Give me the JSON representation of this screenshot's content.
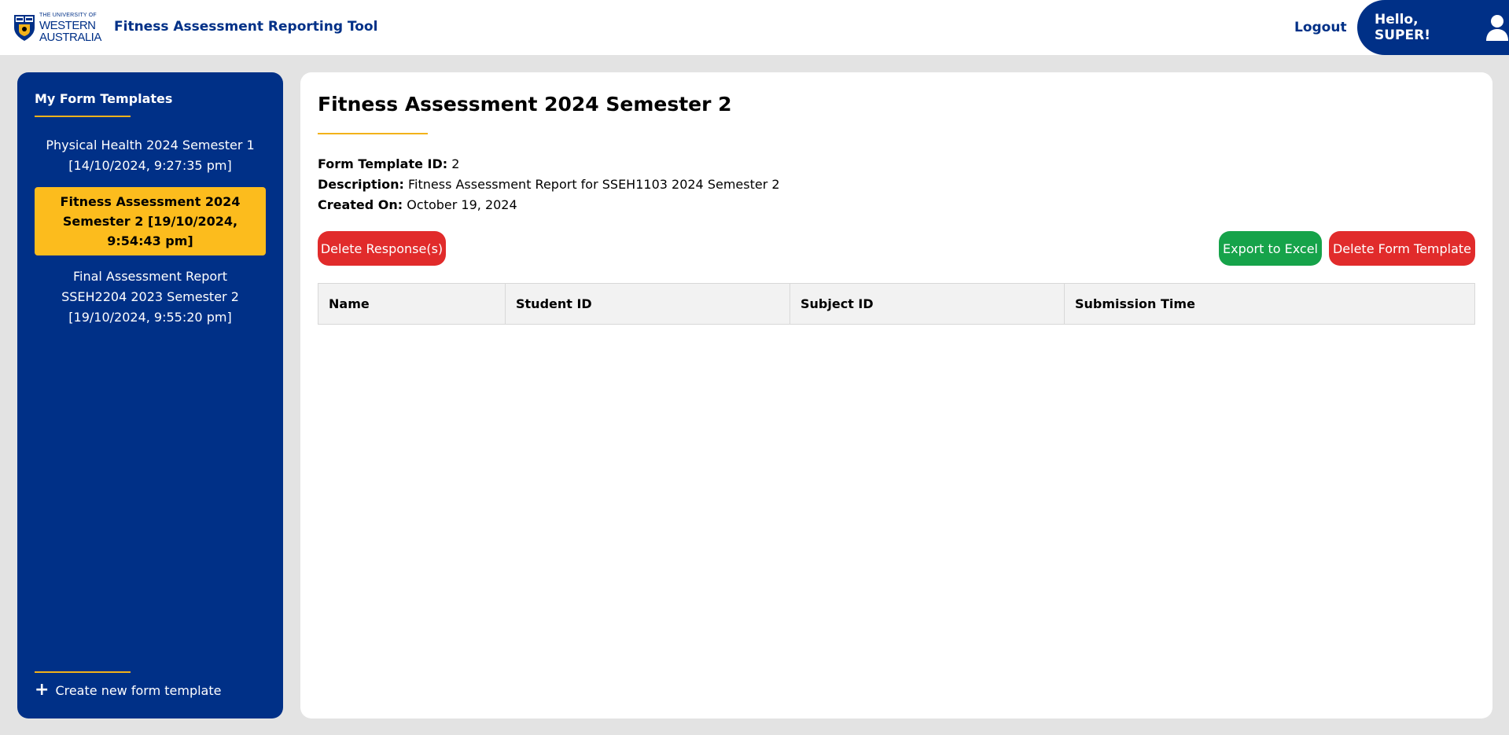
{
  "header": {
    "logo_small": "THE UNIVERSITY OF",
    "logo_line1": "WESTERN",
    "logo_line2": "AUSTRALIA",
    "app_title": "Fitness Assessment Reporting Tool",
    "logout_label": "Logout",
    "greeting": "Hello, SUPER!"
  },
  "sidebar": {
    "heading": "My Form Templates",
    "items": [
      {
        "label": "Physical Health 2024 Semester 1 [14/10/2024, 9:27:35 pm]",
        "active": false
      },
      {
        "label": "Fitness Assessment 2024 Semester 2 [19/10/2024, 9:54:43 pm]",
        "active": true
      },
      {
        "label": "Final Assessment Report SSEH2204 2023 Semester 2 [19/10/2024, 9:55:20 pm]",
        "active": false
      }
    ],
    "create_label": "Create new form template",
    "create_icon": "plus-icon"
  },
  "main": {
    "title": "Fitness Assessment 2024 Semester 2",
    "template_id_label": "Form Template ID:",
    "template_id": "2",
    "description_label": "Description:",
    "description": "Fitness Assessment Report for SSEH1103 2024 Semester 2",
    "created_label": "Created On:",
    "created": "October 19, 2024",
    "buttons": {
      "delete_responses": "Delete Response(s)",
      "export_excel": "Export to Excel",
      "delete_template": "Delete Form Template"
    },
    "table": {
      "columns": [
        "Name",
        "Student ID",
        "Subject ID",
        "Submission Time"
      ],
      "rows": []
    }
  },
  "colors": {
    "brand_blue": "#003087",
    "gold": "#fcbc1d",
    "gold_line": "#f2b21a",
    "danger": "#e12b2b",
    "success": "#16a34a"
  }
}
